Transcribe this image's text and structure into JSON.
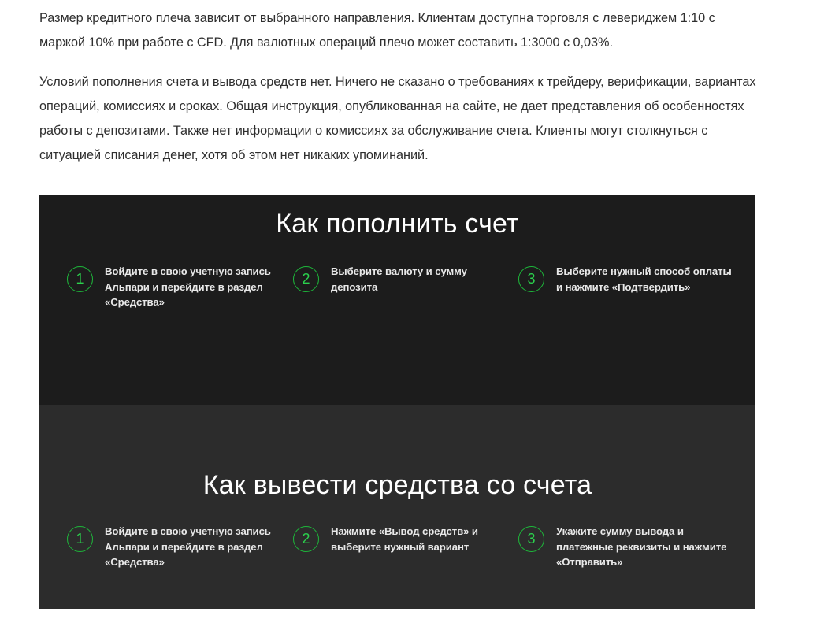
{
  "article": {
    "paragraphs": [
      "Размер кредитного плеча зависит от выбранного направления. Клиентам доступна торговля с левериджем 1:10 с маржой 10% при работе с CFD. Для валютных операций плечо может составить 1:3000 с 0,03%.",
      "Условий пополнения счета и вывода средств нет. Ничего не сказано о требованиях к трейдеру, верификации, вариантах операций, комиссиях и сроках. Общая инструкция, опубликованная на сайте, не дает представления об особенностях работы с депозитами. Также нет информации о комиссиях за обслуживание счета. Клиенты могут столкнуться с ситуацией списания денег, хотя об этом нет никаких упоминаний."
    ]
  },
  "banner": {
    "colors": {
      "top_bg": "#1c1c1c",
      "bottom_bg": "#2c2c2c",
      "accent": "#1db83a",
      "title": "#ffffff",
      "text": "#e8e8e8"
    },
    "deposit": {
      "title": "Как пополнить счет",
      "steps": [
        {
          "num": "1",
          "text": "Войдите в свою учетную запись Альпари и перейдите в раздел «Средства»"
        },
        {
          "num": "2",
          "text": "Выберите валюту и сумму депозита"
        },
        {
          "num": "3",
          "text": "Выберите нужный способ оплаты и нажмите «Подтвердить»"
        }
      ]
    },
    "withdraw": {
      "title": "Как вывести средства со счета",
      "steps": [
        {
          "num": "1",
          "text": "Войдите в свою учетную запись Альпари и перейдите в раздел «Средства»"
        },
        {
          "num": "2",
          "text": "Нажмите «Вывод средств» и выберите нужный вариант"
        },
        {
          "num": "3",
          "text": "Укажите сумму вывода и платежные реквизиты и нажмите «Отправить»"
        }
      ]
    }
  }
}
